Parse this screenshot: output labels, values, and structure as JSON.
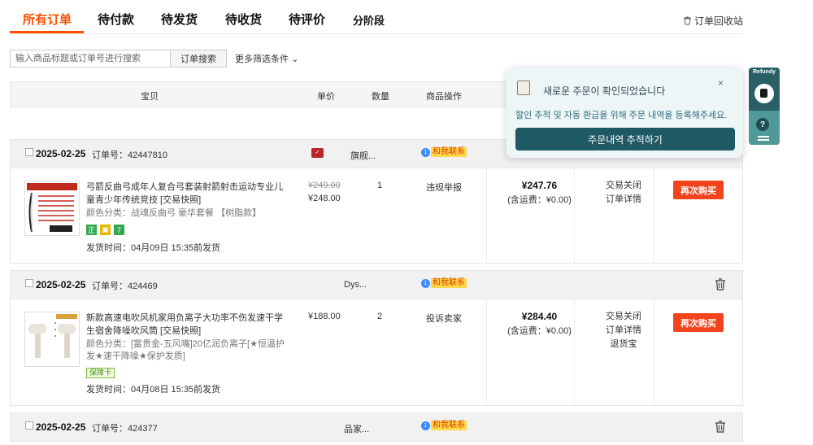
{
  "tabs": [
    {
      "label": "所有订单"
    },
    {
      "label": "待付款"
    },
    {
      "label": "待发货"
    },
    {
      "label": "待收货"
    },
    {
      "label": "待评价"
    },
    {
      "label": "分阶段"
    }
  ],
  "recycle_label": "订单回收站",
  "search": {
    "placeholder": "输入商品标题或订单号进行搜索",
    "button": "订单搜索",
    "more": "更多筛选条件"
  },
  "table_header": {
    "item": "宝贝",
    "price": "单价",
    "qty": "数量",
    "ops": "商品操作"
  },
  "contact_label": "和我联系",
  "orders": [
    {
      "date": "2025-02-25",
      "order_no": "订单号：42447810",
      "shop": "旗舰...",
      "title": "弓箭反曲弓成年人复合弓套装射箭射击运动专业儿童青少年传统竞技 [交易快照]",
      "attr": "颜色分类：战魂反曲弓 豪华套餐 【树脂款】",
      "ship": "发货时间：04月09日 15:35前发货",
      "price_old": "¥249.00",
      "price": "¥248.00",
      "qty": "1",
      "op": "违规举报",
      "total": "¥247.76",
      "ship_fee": "(含运费：¥0.00)",
      "status": [
        "交易关闭",
        "订单详情"
      ],
      "rebuy": "再次购买",
      "badges": [
        "正",
        "7"
      ]
    },
    {
      "date": "2025-02-25",
      "order_no": "订单号：424469",
      "shop": "Dys...",
      "title": "新款高速电吹风机家用负离子大功率不伤发速干学生宿舍降噪吹风筒 [交易快照]",
      "attr": "颜色分类：[富贵金-五风嘴]20亿润负离子[★恒温护发★速干降噪★保护发质]",
      "ship": "发货时间：04月08日 15:35前发货",
      "price": "¥188.00",
      "qty": "2",
      "op": "投诉卖家",
      "total": "¥284.40",
      "ship_fee": "(含运费：¥0.00)",
      "status": [
        "交易关闭",
        "订单详情",
        "退货宝"
      ],
      "rebuy": "再次购买",
      "bz_badge": "保障卡"
    },
    {
      "date": "2025-02-25",
      "order_no": "订单号：424377",
      "shop": "品家..."
    }
  ],
  "popup": {
    "title": "새로운 주문이 확인되었습니다",
    "close": "×",
    "message": "할인 추적 및 자동 환급을 위해 주문 내역을 등록해주세요.",
    "button": "주문내역 추적하기"
  },
  "side": {
    "brand": "Refundy",
    "help": "?"
  },
  "colors": {
    "accent": "#ff5000",
    "rebuy": "#f2441c",
    "popup_btn": "#1f5a64"
  }
}
